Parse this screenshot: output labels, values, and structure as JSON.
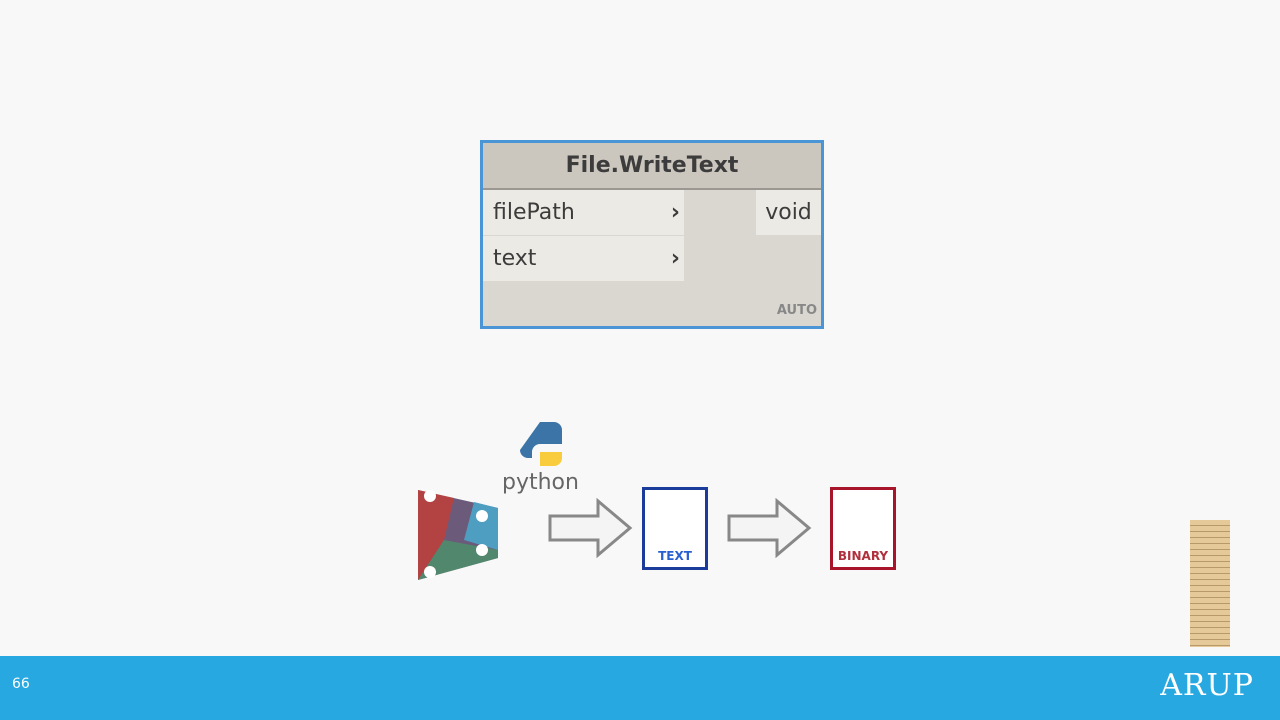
{
  "node": {
    "title": "File.WriteText",
    "inputs": [
      {
        "label": "filePath"
      },
      {
        "label": "text"
      }
    ],
    "output": "void",
    "run_mode": "AUTO",
    "border_color": "#4a95d6"
  },
  "diagram": {
    "python_label": "python",
    "text_file_label": "TEXT",
    "binary_file_label": "BINARY",
    "icons": [
      "dynamo-logo-icon",
      "python-logo-icon",
      "arrow-right-icon",
      "text-file-icon",
      "arrow-right-icon",
      "binary-file-icon",
      "jenga-tower-icon"
    ]
  },
  "footer": {
    "page_number": "66",
    "logo": "ARUP",
    "color": "#27a8e0"
  }
}
